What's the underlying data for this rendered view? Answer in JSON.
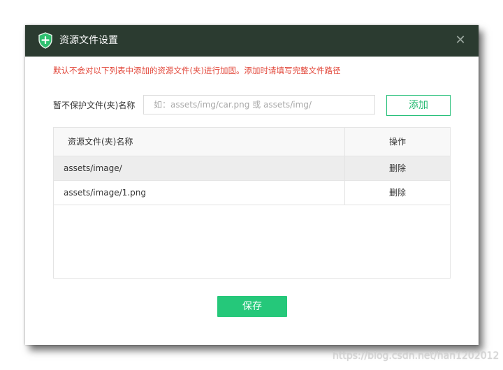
{
  "dialog": {
    "title": "资源文件设置",
    "close_icon": "close-icon",
    "app_icon": "shield-icon",
    "notice": "默认不会对以下列表中添加的资源文件(夹)进行加固。添加时请填写完整文件路径",
    "form": {
      "label": "暂不保护文件(夹)名称",
      "placeholder": "如：assets/img/car.png 或 assets/img/",
      "value": "",
      "add_button": "添加"
    },
    "table": {
      "columns": [
        "资源文件(夹)名称",
        "操作"
      ],
      "rows": [
        {
          "name": "assets/image/",
          "action": "删除"
        },
        {
          "name": "assets/image/1.png",
          "action": "删除"
        }
      ]
    },
    "save_button": "保存"
  },
  "colors": {
    "titlebar": "#2b3b30",
    "accent_green": "#25c87a",
    "notice_red": "#e2473a"
  },
  "watermark": "https://blog.csdn.net/han1202012"
}
